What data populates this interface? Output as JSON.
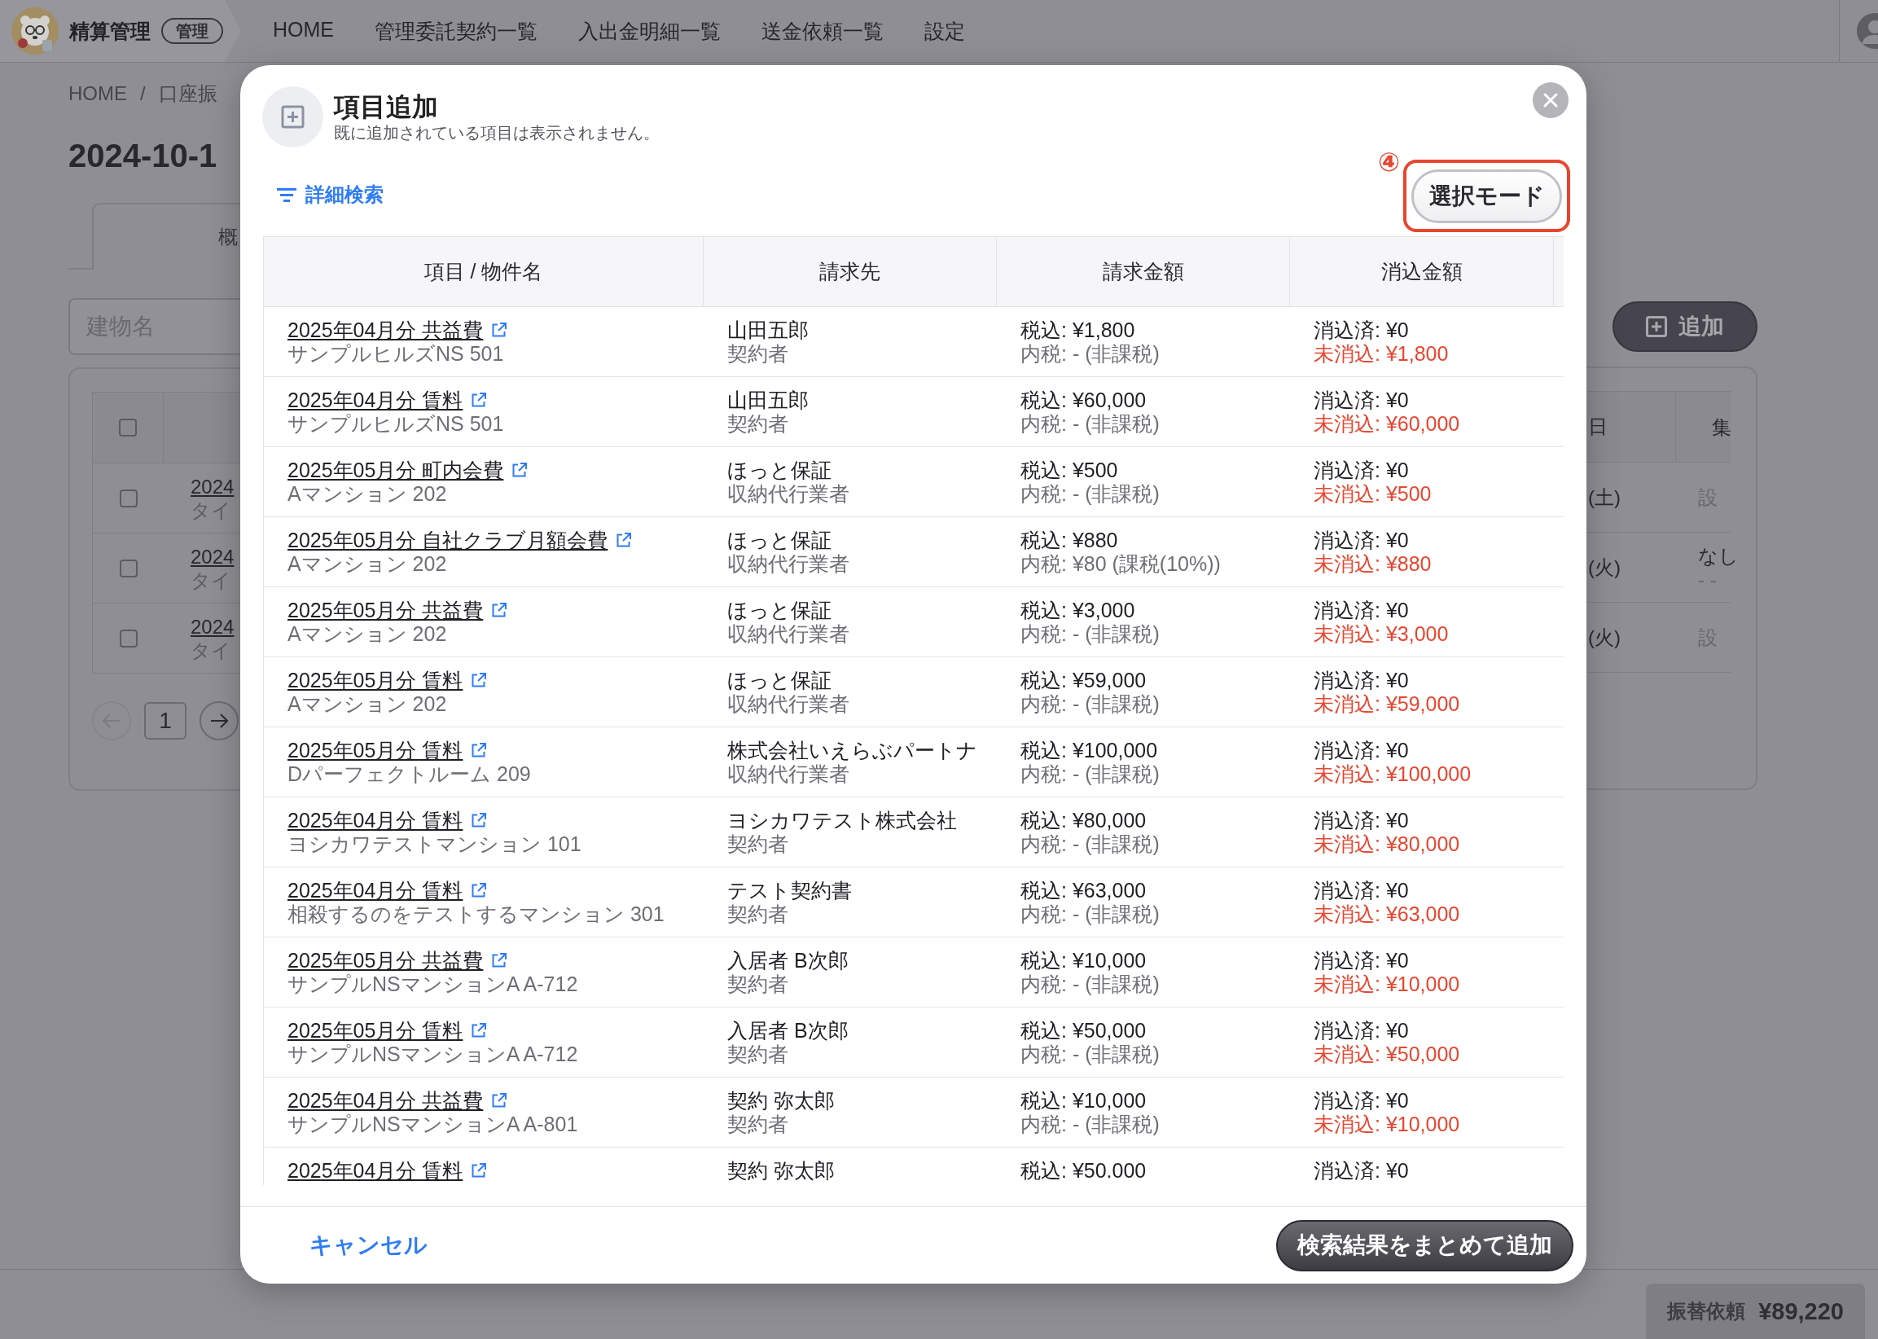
{
  "nav": {
    "brand": "精算管理",
    "badge": "管理",
    "items": [
      "HOME",
      "管理委託契約一覧",
      "入出金明細一覧",
      "送金依頼一覧",
      "設定"
    ]
  },
  "page": {
    "breadcrumb": {
      "items": [
        "HOME",
        "口座振"
      ],
      "separator": "/"
    },
    "heading": "2024-10-1",
    "tab": "概",
    "search": {
      "placeholder": "建物名"
    },
    "add_button": "追加",
    "table": {
      "header_checked": false,
      "columns": [
        "日",
        "集"
      ],
      "rows": [
        {
          "checked": false,
          "title": "2024",
          "subtitle": "タイ",
          "date": "(土)",
          "last_column": {
            "kind": "action",
            "text": "設"
          }
        },
        {
          "checked": false,
          "title": "2024",
          "subtitle": "タイ",
          "date": "(火)",
          "last_column": {
            "kind": "value",
            "text": "なし",
            "sub": "- -"
          }
        },
        {
          "checked": false,
          "title": "2024",
          "subtitle": "タイ",
          "date": "(火)",
          "last_column": {
            "kind": "action",
            "text": "設"
          }
        }
      ]
    },
    "pagination": {
      "page": "1",
      "prev": {
        "disabled": true
      },
      "next": {
        "disabled": false
      }
    },
    "total": {
      "label": "振替依頼",
      "amount": "¥89,220"
    }
  },
  "modal": {
    "title": "項目追加",
    "subtitle": "既に追加されている項目は表示されません。",
    "filter_link": "詳細検索",
    "annotation": "④",
    "select_mode": {
      "label": "選択モード",
      "highlighted": true
    },
    "columns": [
      "項目 / 物件名",
      "請求先",
      "請求金額",
      "消込金額"
    ],
    "rows": [
      {
        "title": "2025年04月分 共益費",
        "property": "サンプルヒルズNS 501",
        "payer": "山田五郎",
        "payer_role": "契約者",
        "amount": "税込: ¥1,800",
        "tax": "内税: - (非課税)",
        "cleared": "消込済: ¥0",
        "uncleared": "未消込: ¥1,800"
      },
      {
        "title": "2025年04月分 賃料",
        "property": "サンプルヒルズNS 501",
        "payer": "山田五郎",
        "payer_role": "契約者",
        "amount": "税込: ¥60,000",
        "tax": "内税: - (非課税)",
        "cleared": "消込済: ¥0",
        "uncleared": "未消込: ¥60,000"
      },
      {
        "title": "2025年05月分 町内会費",
        "property": "Aマンション 202",
        "payer": "ほっと保証",
        "payer_role": "収納代行業者",
        "amount": "税込: ¥500",
        "tax": "内税: - (非課税)",
        "cleared": "消込済: ¥0",
        "uncleared": "未消込: ¥500"
      },
      {
        "title": "2025年05月分 自社クラブ月額会費",
        "property": "Aマンション 202",
        "payer": "ほっと保証",
        "payer_role": "収納代行業者",
        "amount": "税込: ¥880",
        "tax": "内税: ¥80 (課税(10%))",
        "cleared": "消込済: ¥0",
        "uncleared": "未消込: ¥880"
      },
      {
        "title": "2025年05月分 共益費",
        "property": "Aマンション 202",
        "payer": "ほっと保証",
        "payer_role": "収納代行業者",
        "amount": "税込: ¥3,000",
        "tax": "内税: - (非課税)",
        "cleared": "消込済: ¥0",
        "uncleared": "未消込: ¥3,000"
      },
      {
        "title": "2025年05月分 賃料",
        "property": "Aマンション 202",
        "payer": "ほっと保証",
        "payer_role": "収納代行業者",
        "amount": "税込: ¥59,000",
        "tax": "内税: - (非課税)",
        "cleared": "消込済: ¥0",
        "uncleared": "未消込: ¥59,000"
      },
      {
        "title": "2025年05月分 賃料",
        "property": "Dパーフェクトルーム 209",
        "payer": "株式会社いえらぶパートナ",
        "payer_role": "収納代行業者",
        "amount": "税込: ¥100,000",
        "tax": "内税: - (非課税)",
        "cleared": "消込済: ¥0",
        "uncleared": "未消込: ¥100,000"
      },
      {
        "title": "2025年04月分 賃料",
        "property": "ヨシカワテストマンション 101",
        "payer": "ヨシカワテスト株式会社",
        "payer_role": "契約者",
        "amount": "税込: ¥80,000",
        "tax": "内税: - (非課税)",
        "cleared": "消込済: ¥0",
        "uncleared": "未消込: ¥80,000"
      },
      {
        "title": "2025年04月分 賃料",
        "property": "相殺するのをテストするマンション 301",
        "payer": "テスト契約書",
        "payer_role": "契約者",
        "amount": "税込: ¥63,000",
        "tax": "内税: - (非課税)",
        "cleared": "消込済: ¥0",
        "uncleared": "未消込: ¥63,000"
      },
      {
        "title": "2025年05月分 共益費",
        "property": "サンプルNSマンションA A-712",
        "payer": "入居者 B次郎",
        "payer_role": "契約者",
        "amount": "税込: ¥10,000",
        "tax": "内税: - (非課税)",
        "cleared": "消込済: ¥0",
        "uncleared": "未消込: ¥10,000"
      },
      {
        "title": "2025年05月分 賃料",
        "property": "サンプルNSマンションA A-712",
        "payer": "入居者 B次郎",
        "payer_role": "契約者",
        "amount": "税込: ¥50,000",
        "tax": "内税: - (非課税)",
        "cleared": "消込済: ¥0",
        "uncleared": "未消込: ¥50,000"
      },
      {
        "title": "2025年04月分 共益費",
        "property": "サンプルNSマンションA A-801",
        "payer": "契約 弥太郎",
        "payer_role": "契約者",
        "amount": "税込: ¥10,000",
        "tax": "内税: - (非課税)",
        "cleared": "消込済: ¥0",
        "uncleared": "未消込: ¥10,000"
      },
      {
        "title": "2025年04月分 賃料",
        "payer": "契約 弥太郎",
        "amount": "税込: ¥50.000",
        "cleared": "消込済: ¥0"
      }
    ],
    "cancel": "キャンセル",
    "submit": "検索結果をまとめて追加"
  }
}
